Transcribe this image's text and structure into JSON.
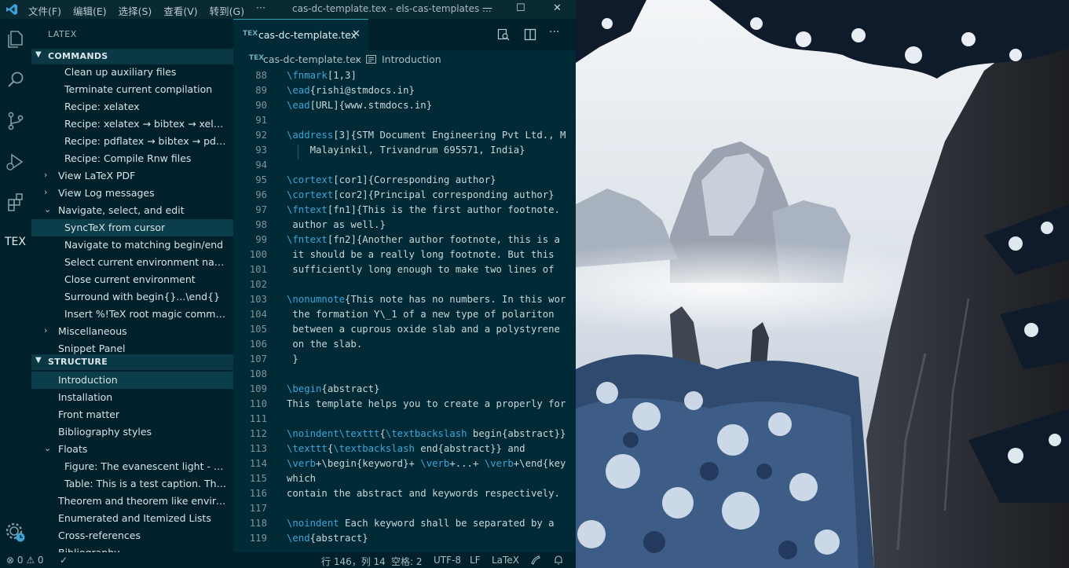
{
  "titlebar": {
    "menus": [
      "文件(F)",
      "编辑(E)",
      "选择(S)",
      "查看(V)",
      "转到(G)"
    ],
    "more": "···",
    "title": "cas-dc-template.tex - els-cas-templates ...",
    "minimize": "—",
    "maximize": "☐",
    "close": "✕"
  },
  "activity": {
    "tex_label": "TEX"
  },
  "sidebar": {
    "header": "LATEX",
    "commands_title": "COMMANDS",
    "structure_title": "STRUCTURE",
    "commands": [
      "Clean up auxiliary files",
      "Terminate current compilation",
      "Recipe: xelatex",
      "Recipe: xelatex → bibtex → xelat...",
      "Recipe: pdflatex → bibtex → pdfl...",
      "Recipe: Compile Rnw files",
      "View LaTeX PDF",
      "View Log messages",
      "Navigate, select, and edit",
      "SyncTeX from cursor",
      "Navigate to matching begin/end",
      "Select current environment name",
      "Close current environment",
      "Surround with begin{}...\\end{}",
      "Insert %!TeX root magic comment",
      "Miscellaneous",
      "Snippet Panel"
    ],
    "structure": [
      "Introduction",
      "Installation",
      "Front matter",
      "Bibliography styles",
      "Floats",
      "Figure:  The evanescent light - $1...",
      "Table:  This is a test caption. This i...",
      "Theorem and theorem like environ...",
      "Enumerated and Itemized Lists",
      "Cross-references",
      "Bibliography"
    ]
  },
  "editor": {
    "tab_icon": "TEX",
    "tab_name": "cas-dc-template.tex",
    "tab_close": "✕",
    "breadcrumb_file": "cas-dc-template.tex",
    "breadcrumb_sep": "›",
    "breadcrumb_section": "Introduction",
    "lines": [
      {
        "n": "88",
        "parts": [
          [
            "kw",
            "\\fnmark"
          ],
          [
            "t",
            "[1,3]"
          ]
        ]
      },
      {
        "n": "89",
        "parts": [
          [
            "kw",
            "\\ead"
          ],
          [
            "t",
            "{rishi@stmdocs.in}"
          ]
        ]
      },
      {
        "n": "90",
        "parts": [
          [
            "kw",
            "\\ead"
          ],
          [
            "t",
            "[URL]{www.stmdocs.in}"
          ]
        ]
      },
      {
        "n": "91",
        "parts": []
      },
      {
        "n": "92",
        "parts": [
          [
            "kw",
            "\\address"
          ],
          [
            "t",
            "[3]{STM Document Engineering Pvt Ltd., M"
          ]
        ]
      },
      {
        "n": "",
        "parts": [
          [
            "t",
            "    Malayinkil, Trivandrum 695571, India}"
          ]
        ]
      },
      {
        "n": "93",
        "parts": []
      },
      {
        "n": "94",
        "parts": [
          [
            "kw",
            "\\cortext"
          ],
          [
            "t",
            "[cor1]{Corresponding author}"
          ]
        ]
      },
      {
        "n": "95",
        "parts": [
          [
            "kw",
            "\\cortext"
          ],
          [
            "t",
            "[cor2]{Principal corresponding author}"
          ]
        ]
      },
      {
        "n": "96",
        "parts": [
          [
            "kw",
            "\\fntext"
          ],
          [
            "t",
            "[fn1]{This is the first author footnote. "
          ]
        ]
      },
      {
        "n": "",
        "parts": [
          [
            "t",
            " author as well.}"
          ]
        ]
      },
      {
        "n": "97",
        "parts": [
          [
            "kw",
            "\\fntext"
          ],
          [
            "t",
            "[fn2]{Another author footnote, this is a "
          ]
        ]
      },
      {
        "n": "",
        "parts": [
          [
            "t",
            " it should be a really long footnote. But this "
          ]
        ]
      },
      {
        "n": "",
        "parts": [
          [
            "t",
            " sufficiently long enough to make two lines of "
          ]
        ]
      },
      {
        "n": "98",
        "parts": []
      },
      {
        "n": "99",
        "parts": [
          [
            "kw",
            "\\nonumnote"
          ],
          [
            "t",
            "{This note has no numbers. In this wor"
          ]
        ]
      },
      {
        "n": "",
        "parts": [
          [
            "t",
            " the formation Y\\_1 of a new type of polariton "
          ]
        ]
      },
      {
        "n": "",
        "parts": [
          [
            "t",
            " between a cuprous oxide slab and a polystyrene"
          ]
        ]
      },
      {
        "n": "",
        "parts": [
          [
            "t",
            " on the slab."
          ]
        ]
      },
      {
        "n": "100",
        "parts": [
          [
            "t",
            " }"
          ]
        ]
      },
      {
        "n": "101",
        "parts": []
      },
      {
        "n": "102",
        "parts": [
          [
            "kw",
            "\\begin"
          ],
          [
            "t",
            "{abstract}"
          ]
        ]
      },
      {
        "n": "103",
        "parts": [
          [
            "t",
            "This template helps you to create a properly for"
          ]
        ]
      },
      {
        "n": "104",
        "parts": []
      },
      {
        "n": "105",
        "parts": [
          [
            "kw",
            "\\noindent\\texttt"
          ],
          [
            "t",
            "{"
          ],
          [
            "kw",
            "\\textbackslash"
          ],
          [
            "t",
            " begin{abstract}}"
          ]
        ]
      },
      {
        "n": "106",
        "parts": [
          [
            "kw",
            "\\texttt"
          ],
          [
            "t",
            "{"
          ],
          [
            "kw",
            "\\textbackslash"
          ],
          [
            "t",
            " end{abstract}} and"
          ]
        ]
      },
      {
        "n": "107",
        "parts": [
          [
            "kw",
            "\\verb"
          ],
          [
            "t",
            "+\\begin{keyword}+ "
          ],
          [
            "kw",
            "\\verb"
          ],
          [
            "t",
            "+...+ "
          ],
          [
            "kw",
            "\\verb"
          ],
          [
            "t",
            "+\\end{key"
          ]
        ]
      },
      {
        "n": "108",
        "parts": [
          [
            "t",
            "which"
          ]
        ]
      },
      {
        "n": "109",
        "parts": [
          [
            "t",
            "contain the abstract and keywords respectively."
          ]
        ]
      },
      {
        "n": "110",
        "parts": []
      },
      {
        "n": "111",
        "parts": [
          [
            "kw",
            "\\noindent"
          ],
          [
            "t",
            " Each keyword shall be separated by a "
          ]
        ]
      },
      {
        "n": "112",
        "parts": [
          [
            "kw",
            "\\end"
          ],
          [
            "t",
            "{abstract}"
          ]
        ]
      }
    ],
    "line_numbers_col": [
      "88",
      "89",
      "90",
      "91",
      "92",
      "93",
      "94",
      "95",
      "96",
      "97",
      "98",
      "99",
      "100",
      "101",
      "102",
      "103",
      "104",
      "105",
      "106",
      "107",
      "108",
      "109",
      "110",
      "111",
      "112",
      "113",
      "114",
      "115",
      "116",
      "117",
      "118",
      "119"
    ]
  },
  "statusbar": {
    "problems": "⊗ 0 ⚠ 0",
    "check": "✓",
    "position": "行 146，列 14",
    "spaces": "空格: 2",
    "encoding": "UTF-8",
    "eol": "LF",
    "language": "LaTeX"
  },
  "colors": {
    "editor_bg": "#002b36",
    "sidebar_bg": "#00212b",
    "keyword": "#3ea4d8",
    "text": "#c8d6d8"
  }
}
